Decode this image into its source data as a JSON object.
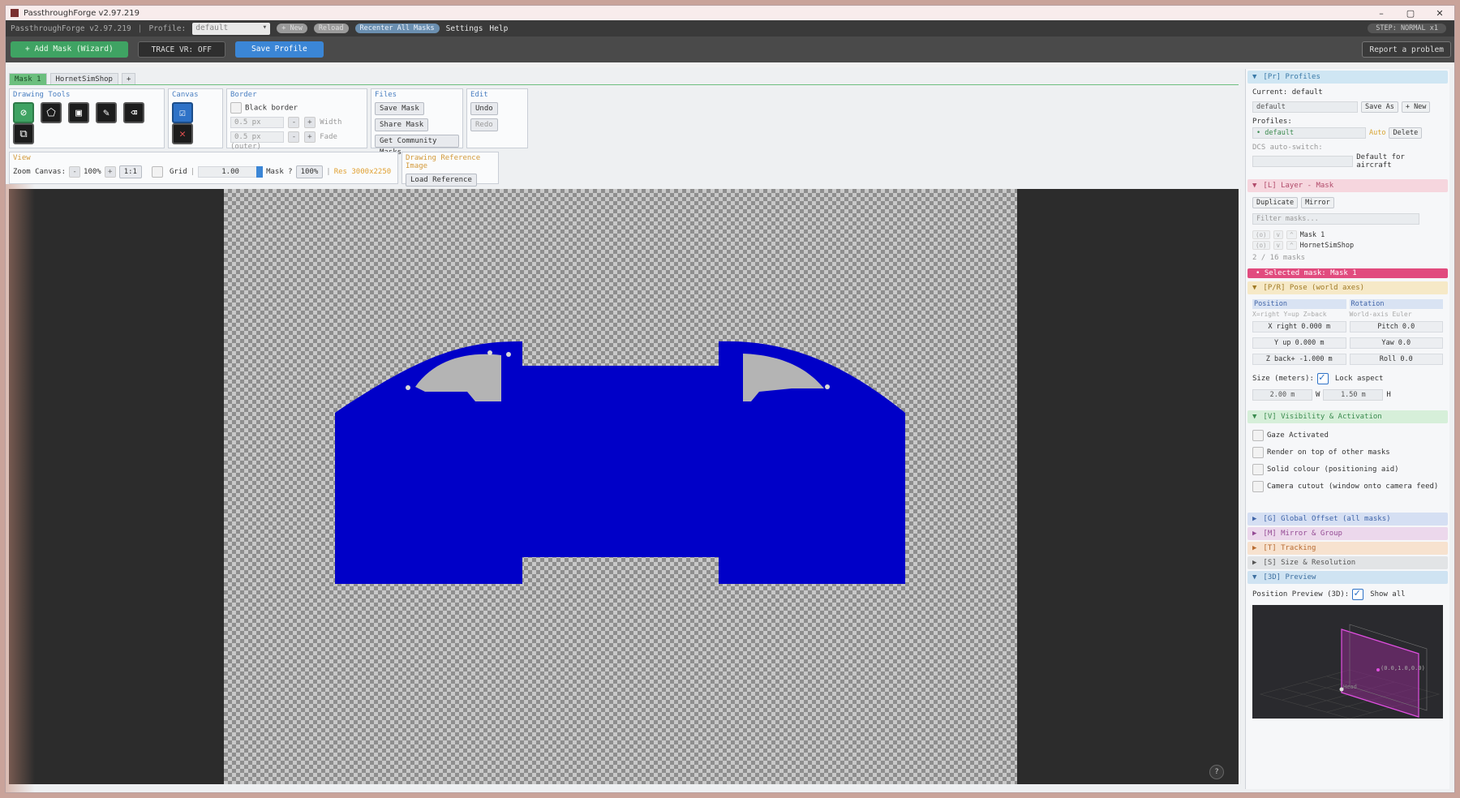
{
  "window": {
    "title": "PassthroughForge v2.97.219",
    "buttons": [
      "–",
      "▢",
      "✕"
    ]
  },
  "menubar": {
    "version": "PassthroughForge v2.97.219",
    "profile_label": "Profile:",
    "profile_value": "default",
    "new": "+ New",
    "reload": "Reload",
    "recenter": "Recenter All Masks",
    "settings": "Settings",
    "help": "Help",
    "step": "STEP: NORMAL  x1"
  },
  "toolbar": {
    "add_mask": "+  Add Mask  (Wizard)",
    "trace_vr": "TRACE VR: OFF",
    "save_profile": "Save Profile",
    "report": "Report a problem"
  },
  "tabs": [
    {
      "label": "Mask 1"
    },
    {
      "label": "HornetSimShop"
    },
    {
      "label": "+"
    }
  ],
  "groups": {
    "drawing_tools": "Drawing Tools",
    "canvas": "Canvas",
    "border": "Border",
    "files": "Files",
    "edit": "Edit",
    "view": "View",
    "reference": "Drawing Reference Image"
  },
  "border": {
    "black_border": "Black border",
    "width_value": "0.5 px",
    "width_label": "Width",
    "fade_value": "0.5 px",
    "fade_label": "Fade (outer)"
  },
  "files": {
    "save": "Save Mask",
    "share": "Share Mask",
    "community": "Get Community Masks"
  },
  "edit": {
    "undo": "Undo",
    "redo": "Redo"
  },
  "view": {
    "zoom_label": "Zoom Canvas:",
    "zoom_value": "100%",
    "one_to_one": "1:1",
    "grid": "Grid",
    "opacity": "1.00",
    "mask_label": "Mask ?",
    "mask_pct": "100%",
    "res": "Res 3000x2250"
  },
  "reference": {
    "load": "Load Reference"
  },
  "panel": {
    "profiles": {
      "header": "[Pr] Profiles",
      "current": "Current: default",
      "name": "default",
      "save_as": "Save As",
      "new": "+ New",
      "profiles_label": "Profiles:",
      "item": "• default",
      "auto": "Auto",
      "delete": "Delete",
      "dcs_label": "DCS auto-switch:",
      "default_for": "Default for aircraft"
    },
    "layer": {
      "header": "[L] Layer - Mask",
      "duplicate": "Duplicate",
      "mirror": "Mirror",
      "filter_placeholder": "Filter masks...",
      "masks": [
        {
          "name": "Mask 1"
        },
        {
          "name": "HornetSimShop"
        }
      ],
      "count": "2 / 16 masks",
      "ctrl_o": "(o)",
      "ctrl_v": "v",
      "ctrl_up": "^"
    },
    "selected": "•  Selected mask:  Mask 1",
    "pose": {
      "header": "[P/R] Pose (world axes)",
      "position": "Position",
      "rotation": "Rotation",
      "pos_hint": "X=right Y=up Z=back",
      "rot_hint": "World-axis Euler",
      "x": "X right  0.000 m",
      "y": "Y up    0.000 m",
      "z": "Z back+ -1.000 m",
      "pitch": "Pitch 0.0",
      "yaw": "Yaw   0.0",
      "roll": "Roll  0.0",
      "size_label": "Size (meters):",
      "lock": "Lock aspect",
      "w_value": "2.00 m",
      "w": "W",
      "h_value": "1.50 m",
      "h": "H"
    },
    "visibility": {
      "header": "[V] Visibility & Activation",
      "items": [
        {
          "label": "Gaze Activated"
        },
        {
          "label": "Render on top of other masks"
        },
        {
          "label": "Solid colour (positioning aid)"
        },
        {
          "label": "Camera cutout (window onto camera feed)"
        }
      ]
    },
    "collapsed": {
      "global": "[G] Global Offset (all masks)",
      "mirror": "[M] Mirror & Group",
      "tracking": "[T] Tracking",
      "size": "[S] Size & Resolution"
    },
    "preview": {
      "header": "[3D] Preview",
      "label": "Position Preview (3D):",
      "show_all": "Show all",
      "head": "Head",
      "coords": "(0.0,1.0,0.0)"
    }
  },
  "canvas": {
    "help": "?"
  },
  "colors": {
    "mask": "#0000c8",
    "accent": "#3fa363",
    "selected": "#e14b7e"
  }
}
